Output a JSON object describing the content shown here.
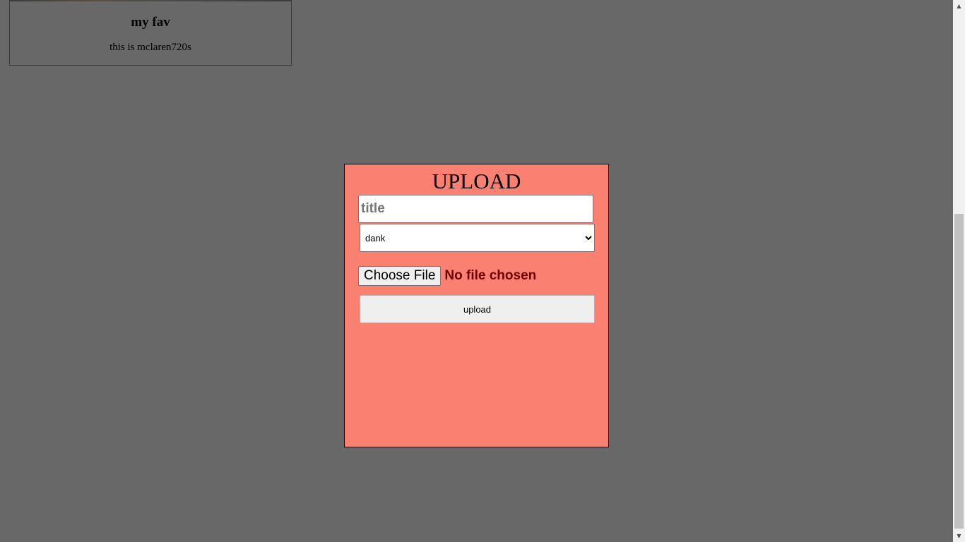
{
  "card": {
    "title": "my fav",
    "description": "this is mclaren720s"
  },
  "upload_modal": {
    "heading": "UPLOAD",
    "title_placeholder": "title",
    "title_value": "",
    "category_selected": "dank",
    "file_button_label": "Choose File",
    "file_status": "No file chosen",
    "submit_label": "upload"
  },
  "icons": {
    "scroll_up": "triangle-up-icon",
    "scroll_down": "triangle-down-icon"
  },
  "colors": {
    "page_background": "#686868",
    "modal_background": "#fa8072",
    "file_status_text": "#6b0000"
  }
}
